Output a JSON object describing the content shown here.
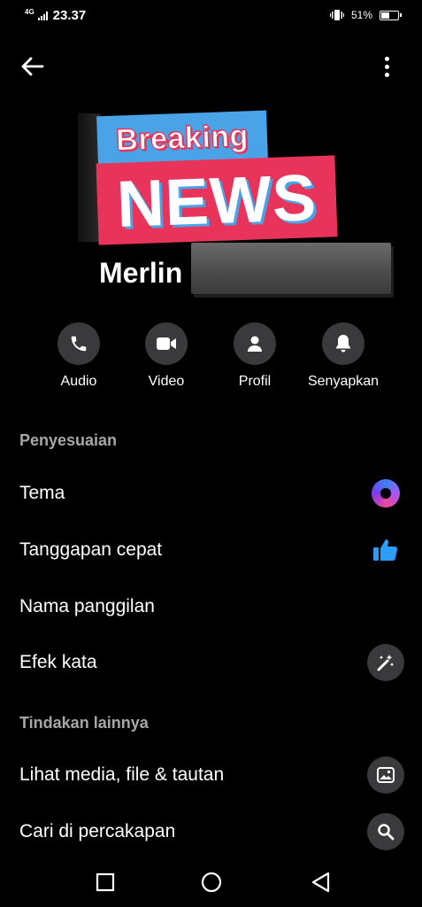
{
  "status_bar": {
    "network": "4G",
    "time": "23.37",
    "battery_text": "51%",
    "battery_level": 0.51
  },
  "header": {
    "back_icon": "arrow-left-icon",
    "more_icon": "more-vertical-icon"
  },
  "profile": {
    "banner_top": "Breaking",
    "banner_bottom": "NEWS",
    "name": "Merlin"
  },
  "actions": [
    {
      "label": "Audio",
      "icon": "phone-icon"
    },
    {
      "label": "Video",
      "icon": "video-camera-icon"
    },
    {
      "label": "Profil",
      "icon": "person-icon"
    },
    {
      "label": "Senyapkan",
      "icon": "bell-icon"
    }
  ],
  "sections": {
    "customization": {
      "title": "Penyesuaian",
      "items": [
        {
          "label": "Tema",
          "icon": "theme-gradient-icon"
        },
        {
          "label": "Tanggapan cepat",
          "icon": "thumbs-up-icon"
        },
        {
          "label": "Nama panggilan"
        },
        {
          "label": "Efek kata",
          "icon": "magic-wand-icon"
        }
      ]
    },
    "more_actions": {
      "title": "Tindakan lainnya",
      "items": [
        {
          "label": "Lihat media, file & tautan",
          "icon": "image-icon"
        },
        {
          "label": "Cari di percakapan",
          "icon": "search-icon"
        }
      ]
    }
  },
  "colors": {
    "background": "#000000",
    "button_bg": "#3a3a3c",
    "section_title": "#a7a7a9",
    "thumbs_up": "#2d9cf4",
    "banner_blue": "#4aa3e6",
    "banner_red": "#e8335a"
  },
  "navbar": {
    "recent_icon": "square-icon",
    "home_icon": "circle-icon",
    "back_icon": "triangle-back-icon"
  }
}
